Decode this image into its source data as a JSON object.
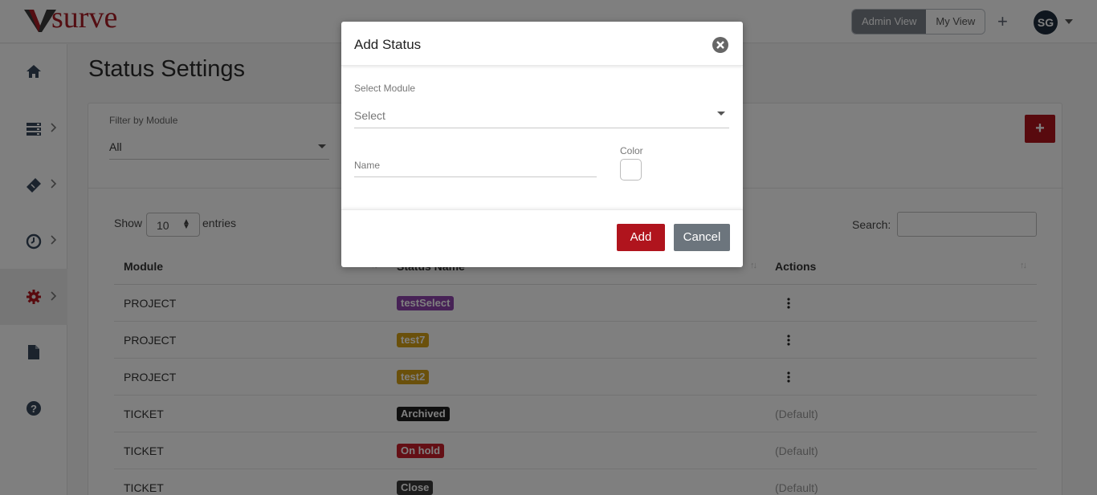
{
  "header": {
    "logo_text": "surve",
    "admin_view_label": "Admin View",
    "my_view_label": "My View",
    "plus_label": "+",
    "avatar_initials": "SG"
  },
  "sidebar": {
    "items": [
      {
        "icon": "home-icon"
      },
      {
        "icon": "server-icon",
        "has_submenu": true
      },
      {
        "icon": "ticket-icon",
        "has_submenu": true
      },
      {
        "icon": "clock-icon",
        "has_submenu": true
      },
      {
        "icon": "gear-icon",
        "has_submenu": true,
        "active": true
      },
      {
        "icon": "file-icon"
      },
      {
        "icon": "help-icon"
      }
    ]
  },
  "page": {
    "title": "Status Settings",
    "filter_label": "Filter by Module",
    "filter_value": "All",
    "add_button_label": "+"
  },
  "table_controls": {
    "show_label": "Show",
    "length_value": "10",
    "entries_label": "entries",
    "search_label": "Search:"
  },
  "table": {
    "columns": [
      "Module",
      "Status Name",
      "Actions"
    ],
    "rows": [
      {
        "module": "PROJECT",
        "status": "testSelect",
        "color": "#8e44ad",
        "action": "menu"
      },
      {
        "module": "PROJECT",
        "status": "test7",
        "color": "#d4a017",
        "action": "menu"
      },
      {
        "module": "PROJECT",
        "status": "test2",
        "color": "#d4a017",
        "action": "menu"
      },
      {
        "module": "TICKET",
        "status": "Archived",
        "color": "#1f1f1f",
        "action": "(Default)"
      },
      {
        "module": "TICKET",
        "status": "On hold",
        "color": "#c81e2a",
        "action": "(Default)"
      },
      {
        "module": "TICKET",
        "status": "Close",
        "color": "#3a3a3a",
        "action": "(Default)"
      }
    ]
  },
  "modal": {
    "title": "Add Status",
    "select_module_label": "Select Module",
    "select_module_placeholder": "Select",
    "name_placeholder": "Name",
    "color_label": "Color",
    "add_button": "Add",
    "cancel_button": "Cancel"
  },
  "colors": {
    "brand": "#b0141d",
    "cancel": "#6c757d"
  }
}
